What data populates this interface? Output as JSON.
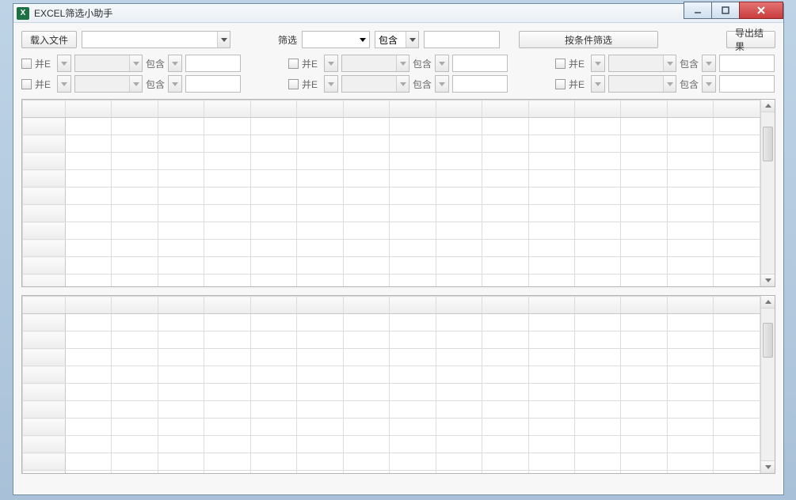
{
  "window": {
    "title": "EXCEL筛选小助手"
  },
  "toolbar": {
    "load_file": "载入文件",
    "filter_label": "筛选",
    "contains_label": "包含",
    "filter_by_conditions": "按条件筛选",
    "export_results": "导出结果"
  },
  "filter_group": {
    "and_label": "并E",
    "contains_label": "包含"
  },
  "grid": {
    "columns": 15,
    "top_rows": 10,
    "bottom_rows": 10
  }
}
